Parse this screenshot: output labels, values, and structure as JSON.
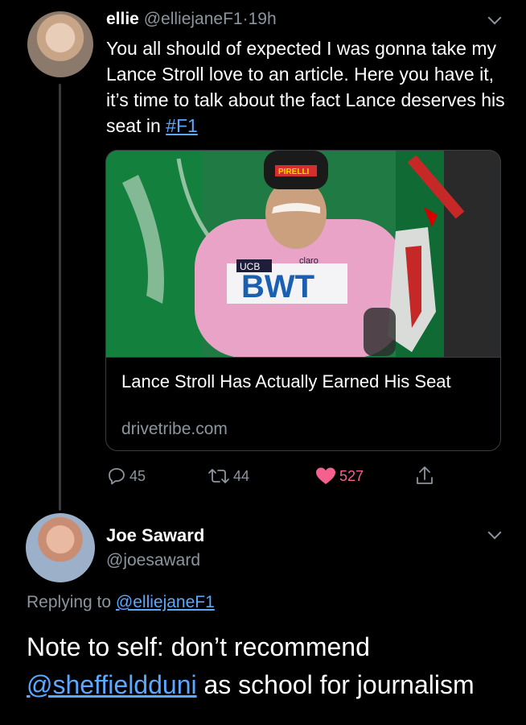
{
  "tweet1": {
    "name": "ellie",
    "handle": "@elliejaneF1",
    "dot": "·",
    "time": "19h",
    "text_main": "You all should of expected I was gonna take my Lance Stroll love to an article. Here you have it, it’s time to talk about the fact Lance deserves his seat in ",
    "hashtag": "#F1",
    "card": {
      "title": "Lance Stroll Has Actually Earned His Seat",
      "domain": "drivetribe.com",
      "image_texts": {
        "cap_brand": "PIRELLI",
        "chest_brand": "BWT",
        "sleeve_logo": "UCB",
        "sponsor": "claro"
      }
    },
    "actions": {
      "replies": "45",
      "retweets": "44",
      "likes": "527"
    }
  },
  "tweet2": {
    "name": "Joe Saward",
    "handle": "@joesaward",
    "replying_prefix": "Replying to ",
    "replying_handle": "@elliejaneF1",
    "text_prefix": "Note to self: don’t recommend ",
    "mention": "@sheffieldduni",
    "text_suffix": " as school for journalism"
  },
  "colors": {
    "background": "#000000",
    "secondary_text": "#8b959e",
    "link": "#5aa8ff",
    "like": "#f5608f"
  },
  "icons": [
    "chevron-down-icon",
    "reply-icon",
    "retweet-icon",
    "heart-icon",
    "share-icon"
  ]
}
